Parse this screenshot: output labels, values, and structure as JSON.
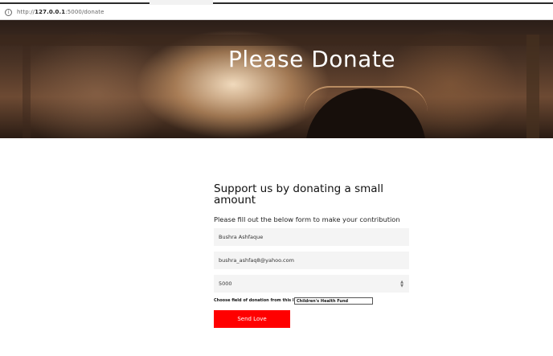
{
  "browser": {
    "url_prefix": "http://",
    "url_host": "127.0.0.1",
    "url_path": ":5000/donate"
  },
  "hero": {
    "title": "Please Donate"
  },
  "form": {
    "heading": "Support us by donating a small amount",
    "subheading": "Please fill out the below form to make your contribution",
    "name_value": "Bushra Ashfaque",
    "email_value": "bushra_ashfaq8@yahoo.com",
    "amount_value": "5000",
    "choose_label": "Choose field of donation from this list:",
    "choose_value": "Children's Health Fund",
    "submit_label": "Send Love"
  },
  "icons": {
    "info": "info-icon",
    "stepper": "stepper-icon"
  }
}
